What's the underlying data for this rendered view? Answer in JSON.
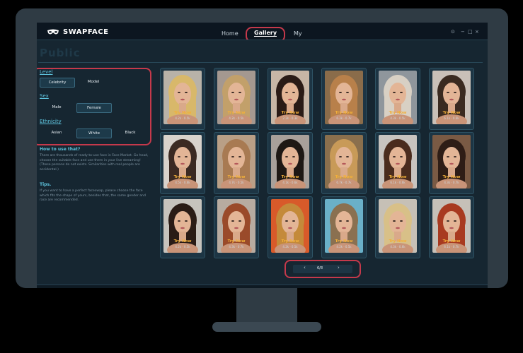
{
  "app": {
    "name": "SWAPFACE"
  },
  "nav": {
    "home": "Home",
    "gallery": "Gallery",
    "my": "My"
  },
  "window_controls": {
    "settings": "⊙",
    "minimize": "−",
    "maximize": "□",
    "close": "×"
  },
  "page": {
    "title": "Public"
  },
  "filters": {
    "level": {
      "label": "Level",
      "options": [
        "Celebrity",
        "Model"
      ],
      "selected": "Celebrity"
    },
    "sex": {
      "label": "Sex",
      "options": [
        "Male",
        "Female"
      ],
      "selected": "Female"
    },
    "ethnicity": {
      "label": "Ethnicity",
      "options": [
        "Asian",
        "White",
        "Black"
      ],
      "selected": "White"
    }
  },
  "info": {
    "howto_title": "How to use that?",
    "howto_text": "There are thousands of ready-to-use face in Face Market. Go head, choose the suitable face and use them in your live streaming! (These persons do not exists. Similarities with real people are accidental.)",
    "tips_title": "Tips.",
    "tips_text": "If you want to have a perfect faceswap, please choose the face which fits the shape of yours, besides that, the same gender and race are recommended."
  },
  "cards": [
    {
      "try": "Try Now",
      "stats": "4.2k · 0.5k",
      "hair": "#d8b86a",
      "bg": "#b8b2a8"
    },
    {
      "try": "Try Now",
      "stats": "4.2k · 0.5k",
      "hair": "#c2a06a",
      "bg": "#a49890"
    },
    {
      "try": "Try Now",
      "stats": "2.2k · 0.3k",
      "hair": "#2a1b16",
      "bg": "#c7b6a6"
    },
    {
      "try": "Try Now",
      "stats": "6.3k · 0.7k",
      "hair": "#b8804a",
      "bg": "#8a6c4a"
    },
    {
      "try": "Try Now",
      "stats": "4.3k · 0.5k",
      "hair": "#d8d0c4",
      "bg": "#8f969c"
    },
    {
      "try": "Try Now",
      "stats": "6.1k · 0.6k",
      "hair": "#3a2a20",
      "bg": "#c9c0b8"
    },
    {
      "try": "Try Now",
      "stats": "4.5k · 0.6k",
      "hair": "#3b2a22",
      "bg": "#d8d2cb"
    },
    {
      "try": "Try Now",
      "stats": "4.7k · 0.5k",
      "hair": "#a87a52",
      "bg": "#b99f86"
    },
    {
      "try": "Try Now",
      "stats": "4.1k · 0.6k",
      "hair": "#1e1814",
      "bg": "#a8a09a"
    },
    {
      "try": "Try Now",
      "stats": "6.7k · 0.7k",
      "hair": "#c89a58",
      "bg": "#8a6f4d"
    },
    {
      "try": "Try Now",
      "stats": "6.1k · 0.6k",
      "hair": "#4a2c1e",
      "bg": "#c8c4c0"
    },
    {
      "try": "Try Now",
      "stats": "4.3k · 0.7k",
      "hair": "#2e1d16",
      "bg": "#7a5a44"
    },
    {
      "try": "Try Now",
      "stats": "4.2k · 0.5k",
      "hair": "#2a1c16",
      "bg": "#c6c3bd"
    },
    {
      "try": "Try Now",
      "stats": "4.3k · 0.7k",
      "hair": "#9a4a2a",
      "bg": "#b7aba0"
    },
    {
      "try": "Try Now",
      "stats": "4.2k · 0.5k",
      "hair": "#c48a3a",
      "bg": "#d85a2a"
    },
    {
      "try": "Try Now",
      "stats": "4.2k · 0.5k",
      "hair": "#8a7050",
      "bg": "#6ab0c8"
    },
    {
      "try": "Try Now",
      "stats": "4.3k · 0.6k",
      "hair": "#d8c088",
      "bg": "#c6c0b6"
    },
    {
      "try": "Try Now",
      "stats": "6.1k · 0.7k",
      "hair": "#a83a20",
      "bg": "#c6c0b8"
    }
  ],
  "pager": {
    "page": "6/8",
    "prev": "‹",
    "next": "›"
  },
  "colors": {
    "accent": "#5ec3dd",
    "highlight_ring": "#c5394b",
    "try_now": "#f2b03a"
  }
}
